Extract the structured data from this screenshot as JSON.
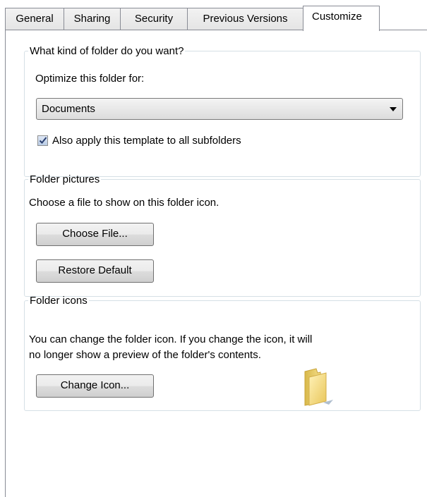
{
  "tabs": [
    {
      "label": "General"
    },
    {
      "label": "Sharing"
    },
    {
      "label": "Security"
    },
    {
      "label": "Previous Versions"
    },
    {
      "label": "Customize",
      "active": true
    }
  ],
  "folder_kind": {
    "legend": "What kind of folder do you want?",
    "optimize_label": "Optimize this folder for:",
    "dropdown_value": "Documents",
    "checkbox_label": "Also apply this template to all subfolders",
    "checkbox_checked": true
  },
  "folder_pictures": {
    "legend": "Folder pictures",
    "description": "Choose a file to show on this folder icon.",
    "choose_file_label": "Choose File...",
    "restore_default_label": "Restore Default"
  },
  "folder_icons": {
    "legend": "Folder icons",
    "description_line1": "You can change the folder icon. If you change the icon, it will",
    "description_line2": "no longer show a preview of the folder's contents.",
    "change_icon_label": "Change Icon...",
    "icon": "folder-icon"
  }
}
